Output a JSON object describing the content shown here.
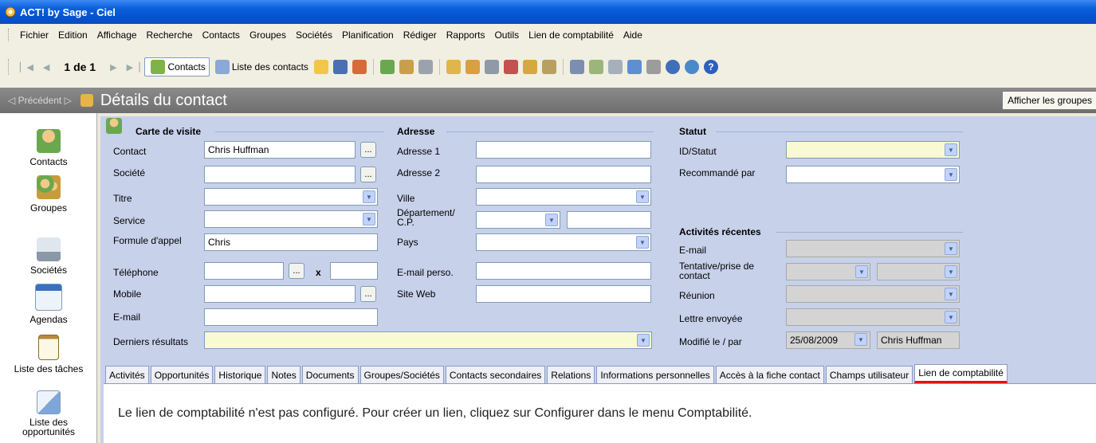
{
  "window": {
    "title": "ACT! by Sage - Ciel"
  },
  "menu": [
    "Fichier",
    "Edition",
    "Affichage",
    "Recherche",
    "Contacts",
    "Groupes",
    "Sociétés",
    "Planification",
    "Rédiger",
    "Rapports",
    "Outils",
    "Lien de comptabilité",
    "Aide"
  ],
  "toolbar": {
    "record_counter": "1 de 1",
    "contacts_label": "Contacts",
    "contact_list_label": "Liste des contacts"
  },
  "header": {
    "previous_label": "Précédent",
    "title": "Détails du contact",
    "show_groups_label": "Afficher les groupes"
  },
  "sidebar": [
    "Contacts",
    "Groupes",
    "Sociétés",
    "Agendas",
    "Liste des tâches",
    "Liste des opportunités"
  ],
  "form": {
    "business_card": {
      "heading": "Carte de visite",
      "contact_label": "Contact",
      "contact_value": "Chris Huffman",
      "company_label": "Société",
      "company_value": "",
      "title_label": "Titre",
      "title_value": "",
      "department_label": "Service",
      "department_value": "",
      "salutation_label": "Formule d'appel",
      "salutation_value": "Chris",
      "phone_label": "Téléphone",
      "phone_value": "",
      "extension_symbol": "x",
      "mobile_label": "Mobile",
      "mobile_value": "",
      "email_label": "E-mail",
      "email_value": "",
      "last_results_label": "Derniers résultats",
      "last_results_value": ""
    },
    "address": {
      "heading": "Adresse",
      "address1_label": "Adresse 1",
      "address2_label": "Adresse 2",
      "city_label": "Ville",
      "state_label": "Département/ C.P.",
      "country_label": "Pays",
      "personal_email_label": "E-mail perso.",
      "website_label": "Site Web"
    },
    "status": {
      "heading": "Statut",
      "id_status_label": "ID/Statut",
      "referred_by_label": "Recommandé par"
    },
    "recent_activities": {
      "heading": "Activités récentes",
      "email_label": "E-mail",
      "call_label": "Tentative/prise de contact",
      "meeting_label": "Réunion",
      "letter_label": "Lettre envoyée",
      "edited_label": "Modifié le / par",
      "edited_date": "25/08/2009",
      "edited_by": "Chris Huffman"
    },
    "dots_symbol": "..."
  },
  "tabs": [
    {
      "label": "Activités",
      "active": false
    },
    {
      "label": "Opportunités",
      "active": false
    },
    {
      "label": "Historique",
      "active": false
    },
    {
      "label": "Notes",
      "active": false
    },
    {
      "label": "Documents",
      "active": false
    },
    {
      "label": "Groupes/Sociétés",
      "active": false
    },
    {
      "label": "Contacts secondaires",
      "active": false
    },
    {
      "label": "Relations",
      "active": false
    },
    {
      "label": "Informations personnelles",
      "active": false
    },
    {
      "label": "Accès à la fiche contact",
      "active": false
    },
    {
      "label": "Champs utilisateur",
      "active": false
    },
    {
      "label": "Lien de comptabilité",
      "active": true
    }
  ],
  "panel": {
    "message": "Le lien de comptabilité n'est pas configuré. Pour créer un lien, cliquez sur Configurer dans le menu Comptabilité."
  },
  "colors": {
    "titlebar": "#0553d0",
    "form_bg": "#c7d1ea",
    "highlight_yellow": "#fafad2",
    "active_tab_underline": "#e81010"
  }
}
